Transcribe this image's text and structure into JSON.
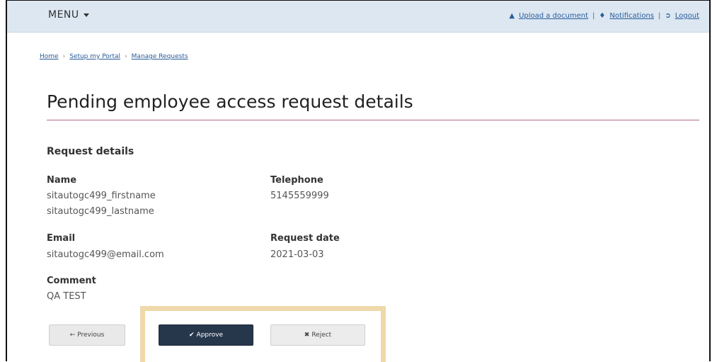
{
  "topbar": {
    "menu_label": "MENU",
    "links": {
      "upload": "Upload a document",
      "notifications": "Notifications",
      "logout": "Logout"
    },
    "separator": "|"
  },
  "breadcrumb": {
    "items": [
      "Home",
      "Setup my Portal",
      "Manage Requests"
    ],
    "separator": "›"
  },
  "page": {
    "title": "Pending employee access request details",
    "section_title": "Request details"
  },
  "details": {
    "name_label": "Name",
    "first_name": "sitautogc499_firstname",
    "last_name": "sitautogc499_lastname",
    "telephone_label": "Telephone",
    "telephone": "5145559999",
    "email_label": "Email",
    "email": "sitautogc499@email.com",
    "request_date_label": "Request date",
    "request_date": "2021-03-03",
    "comment_label": "Comment",
    "comment": "QA TEST"
  },
  "buttons": {
    "previous": "Previous",
    "approve": "Approve",
    "reject": "Reject"
  },
  "colors": {
    "topbar_bg": "#dce7f2",
    "link": "#2a5c9a",
    "title_rule": "#b56a8e",
    "approve_bg": "#27374b",
    "highlight": "#efd8aa"
  }
}
